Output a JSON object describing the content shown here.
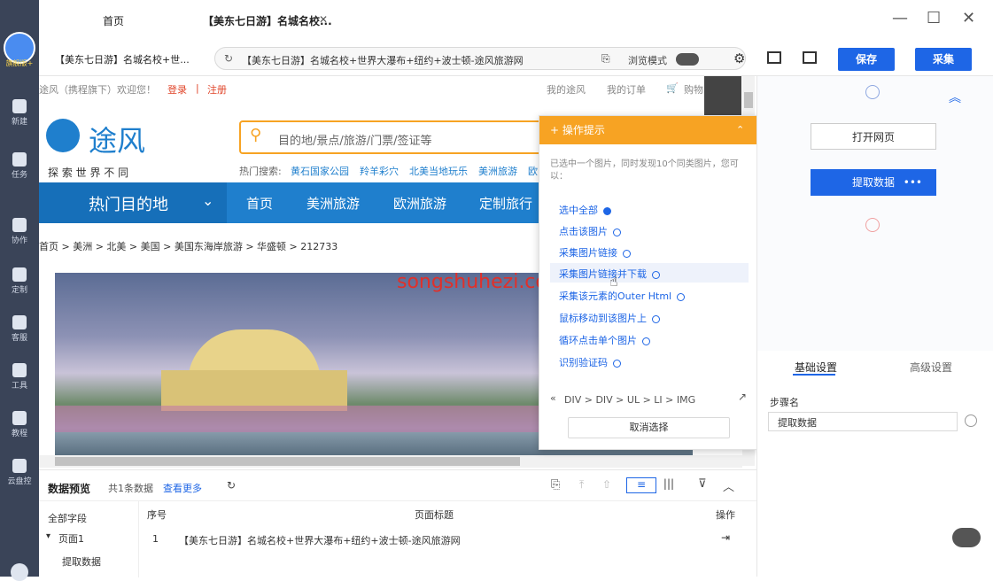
{
  "sidebar": {
    "avatar_label": "旗舰版+",
    "items": [
      "新建",
      "任务",
      "协作",
      "定制",
      "客服",
      "工具",
      "教程",
      "云盘控"
    ]
  },
  "tabs": {
    "home": "首页",
    "active": "【美东七日游】名城名校..."
  },
  "address": {
    "page_title": "【美东七日游】名城名校+世...",
    "url": "【美东七日游】名城名校+世界大瀑布+纽约+波士顿-途风旅游网",
    "browse_mode": "浏览模式",
    "save": "保存",
    "collect": "采集"
  },
  "site": {
    "welcome": "途风（携程旗下）欢迎您！",
    "login": "登录",
    "register": "注册",
    "my_account": "我的途风",
    "my_orders": "我的订单",
    "cart": "购物",
    "logo": "途风",
    "slogan": "探 索 世 界 不 同",
    "search_placeholder": "目的地/景点/旅游/门票/签证等",
    "hot_label": "热门搜索:",
    "hot": [
      "黄石国家公园",
      "羚羊彩穴",
      "北美当地玩乐",
      "美洲旅游",
      "欧"
    ],
    "nav_main": "热门目的地",
    "nav": [
      "首页",
      "美洲旅游",
      "欧洲旅游",
      "定制旅行"
    ],
    "breadcrumb": "首页 > 美洲 > 北美 > 美国 > 美国东海岸旅游 > 华盛顿 > 212733",
    "watermark": "songshuhezi.com"
  },
  "popup": {
    "title": "操作提示",
    "desc": "已选中一个图片，同时发现10个同类图片，您可以：",
    "items": [
      "选中全部",
      "点击该图片",
      "采集图片链接",
      "采集图片链接并下载",
      "采集该元素的Outer Html",
      "鼠标移动到该图片上",
      "循环点击单个图片",
      "识别验证码"
    ],
    "path": "DIV > DIV > UL > LI > IMG",
    "cancel": "取消选择"
  },
  "flow": {
    "open": "打开网页",
    "extract": "提取数据",
    "tabs": [
      "基础设置",
      "高级设置"
    ],
    "step_label": "步骤名",
    "step_value": "提取数据"
  },
  "preview": {
    "title": "数据预览",
    "count": "共1条数据",
    "more": "查看更多",
    "all_fields": "全部字段",
    "page": "页面1",
    "extract": "提取数据",
    "columns": [
      "序号",
      "页面标题",
      "操作"
    ],
    "rows": [
      {
        "index": "1",
        "title": "【美东七日游】名城名校+世界大瀑布+纽约+波士顿-途风旅游网"
      }
    ]
  },
  "colors": {
    "accent": "#1e66e6",
    "popup_header": "#f7a323",
    "nav": "#1f7fcd",
    "sidebar": "#3a4458"
  }
}
